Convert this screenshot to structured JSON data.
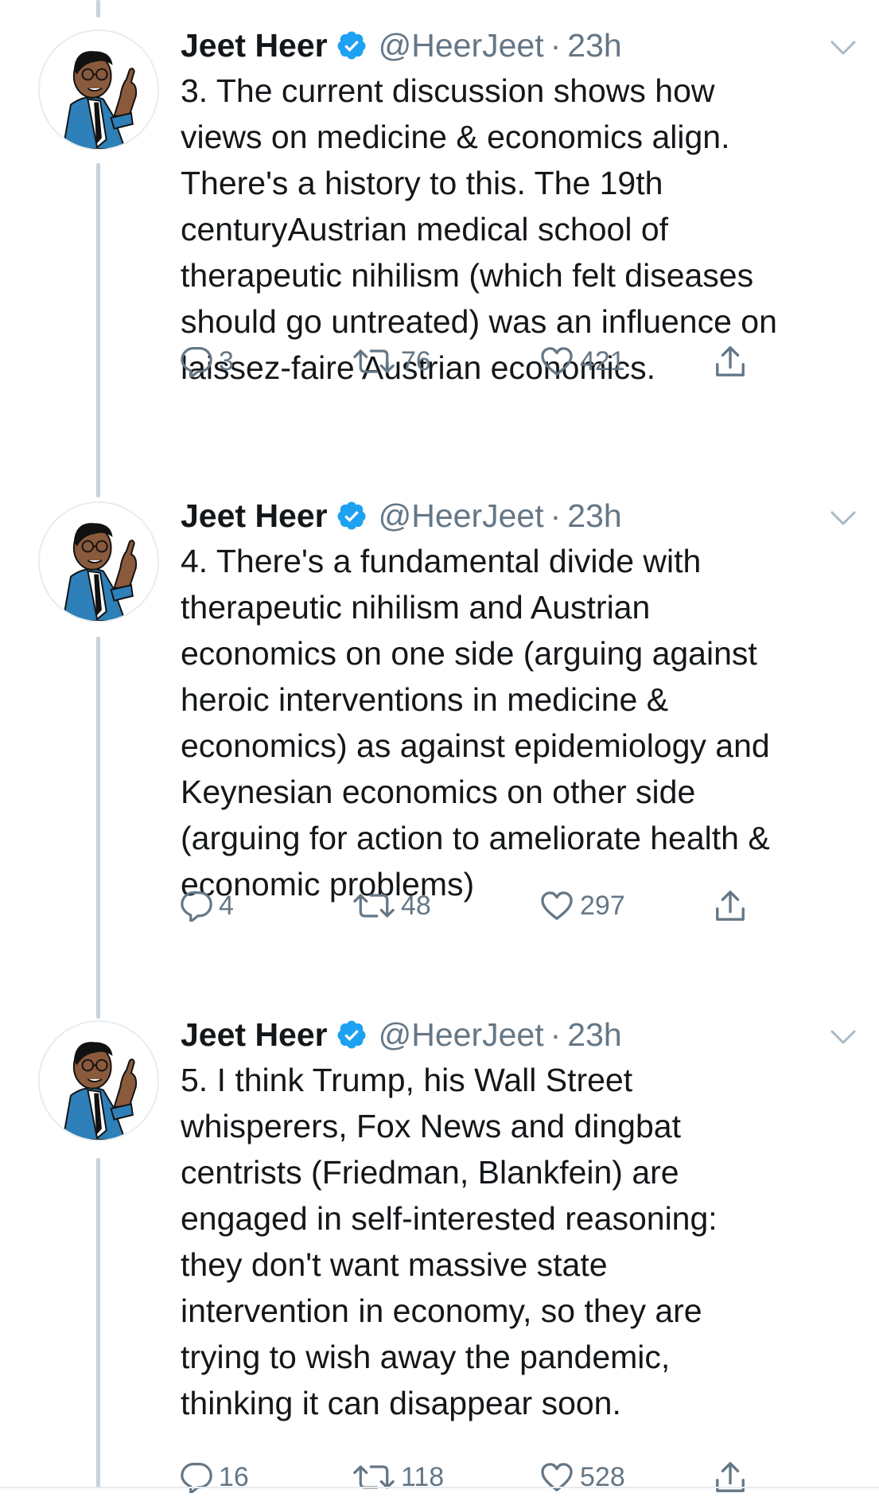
{
  "tweets": [
    {
      "name": "Jeet Heer",
      "handle": "@HeerJeet",
      "dot": "·",
      "time": "23h",
      "text": "3. The current discussion shows how\nviews on medicine & economics align.\nThere's a history to this. The 19th\ncenturyAustrian medical school of\ntherapeutic nihilism (which felt diseases\nshould go untreated) was an influence on\nlaissez-faire Austrian economics.",
      "replies": "3",
      "retweets": "76",
      "likes": "421"
    },
    {
      "name": "Jeet Heer",
      "handle": "@HeerJeet",
      "dot": "·",
      "time": "23h",
      "text": "4. There's a fundamental divide with\ntherapeutic nihilism and Austrian\neconomics on one side (arguing against\nheroic interventions in medicine &\neconomics) as against epidemiology and\nKeynesian economics on other side\n(arguing for action to ameliorate health &\neconomic problems)",
      "replies": "4",
      "retweets": "48",
      "likes": "297"
    },
    {
      "name": "Jeet Heer",
      "handle": "@HeerJeet",
      "dot": "·",
      "time": "23h",
      "text": "5. I think Trump, his Wall Street\nwhisperers, Fox News and dingbat\ncentrists (Friedman, Blankfein) are\nengaged in self-interested reasoning:\nthey don't want massive state\nintervention in economy, so they are\ntrying to wish away the pandemic,\nthinking it can disappear soon.",
      "replies": "16",
      "retweets": "118",
      "likes": "528"
    }
  ],
  "icons": {
    "verified": "verified-badge-icon",
    "caret": "chevron-down-icon",
    "reply": "reply-icon",
    "retweet": "retweet-icon",
    "like": "heart-icon",
    "share": "share-icon"
  },
  "colors": {
    "text": "#14171a",
    "secondary": "#657786",
    "verified": "#1da1f2",
    "thread_line": "#c8d3dc"
  }
}
